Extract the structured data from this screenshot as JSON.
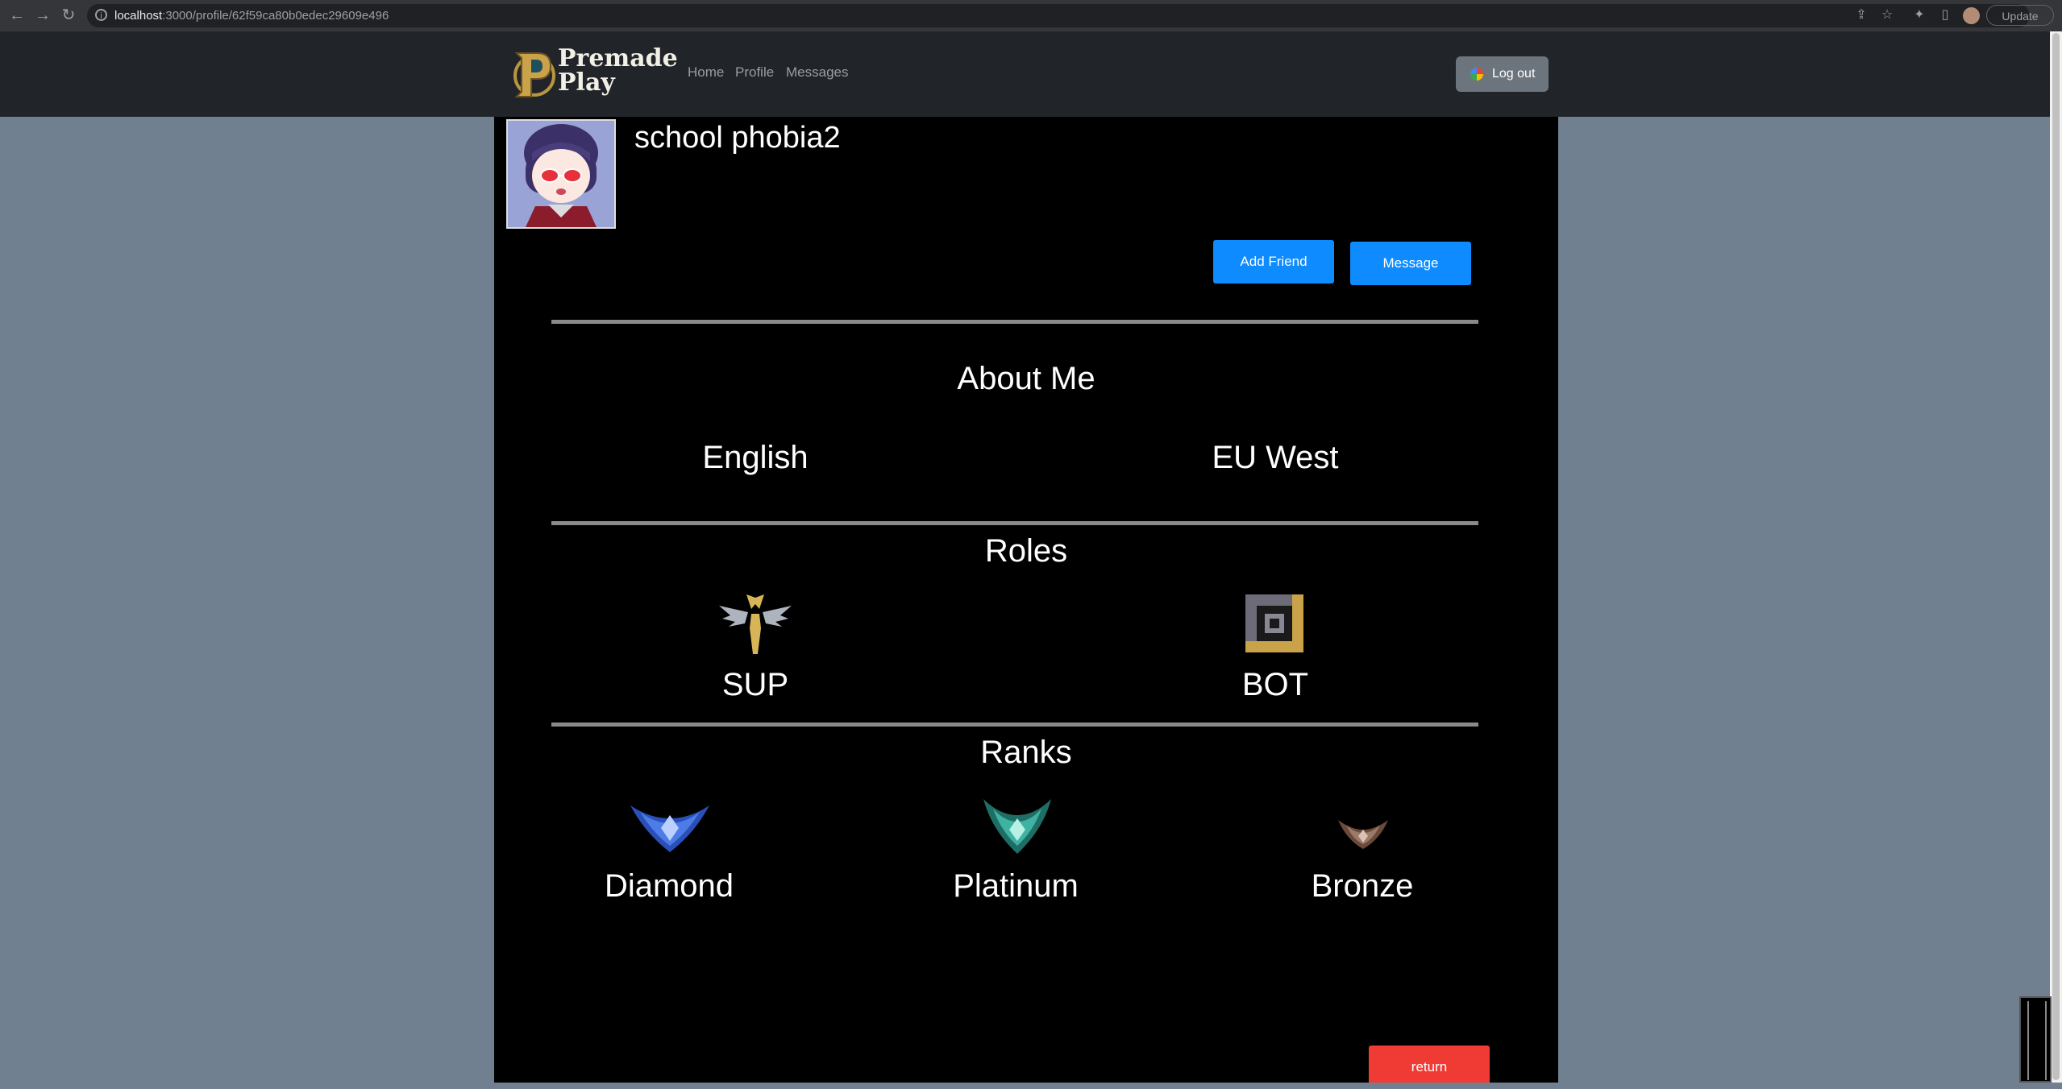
{
  "browser": {
    "url_host": "localhost",
    "url_rest": ":3000/profile/62f59ca80b0edec29609e496",
    "update_label": "Update"
  },
  "navbar": {
    "logo_line1": "Premade",
    "logo_line2": "Play",
    "links": [
      "Home",
      "Profile",
      "Messages"
    ],
    "logout_label": "Log out"
  },
  "profile": {
    "username": "school phobia2",
    "add_friend_label": "Add Friend",
    "message_label": "Message"
  },
  "about": {
    "heading": "About Me",
    "language": "English",
    "region": "EU West"
  },
  "roles": {
    "heading": "Roles",
    "items": [
      "SUP",
      "BOT"
    ]
  },
  "ranks": {
    "heading": "Ranks",
    "items": [
      "Diamond",
      "Platinum",
      "Bronze"
    ]
  },
  "footer": {
    "return_label": "return"
  },
  "colors": {
    "page_bg": "#708090",
    "navbar_bg": "#212529",
    "card_bg": "#000000",
    "primary_button": "#0d8bff",
    "return_button": "#ef3b33",
    "logout_button": "#6c757d"
  }
}
